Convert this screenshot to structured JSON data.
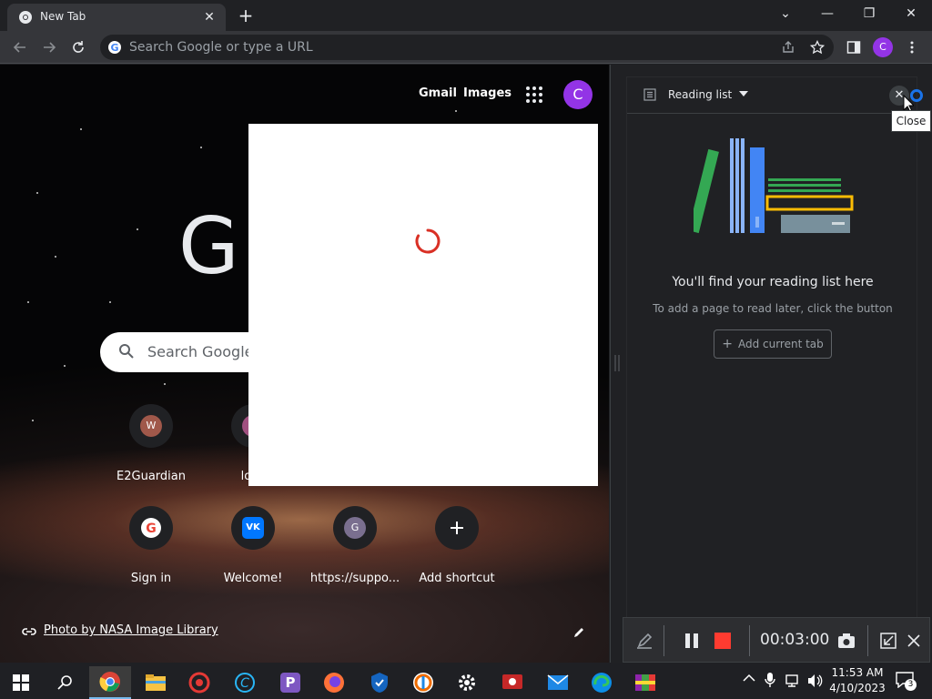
{
  "tab": {
    "title": "New Tab",
    "close": "✕"
  },
  "toolbar": {
    "omnibox_placeholder": "Search Google or type a URL",
    "profile_initial": "C"
  },
  "ntp": {
    "gmail": "Gmail",
    "images": "Images",
    "profile_initial": "C",
    "logo_partial": "G",
    "search_placeholder": "Search Google o",
    "shortcuts": [
      {
        "label": "E2Guardian",
        "initial": "W"
      },
      {
        "label": "loca"
      },
      {
        "label": "Sign in"
      },
      {
        "label": "Welcome!"
      },
      {
        "label": "https://suppo...",
        "initial": "G"
      },
      {
        "label": "Add shortcut"
      }
    ],
    "photo_credit": "Photo by NASA Image Library"
  },
  "side_panel": {
    "title": "Reading list",
    "empty_title": "You'll find your reading list here",
    "empty_subtitle": "To add a page to read later, click the button",
    "add_button": "Add current tab",
    "tooltip": "Close"
  },
  "recorder": {
    "time": "00:03:00"
  },
  "taskbar": {
    "time": "11:53 AM",
    "date": "4/10/2023",
    "notification_count": "3"
  }
}
